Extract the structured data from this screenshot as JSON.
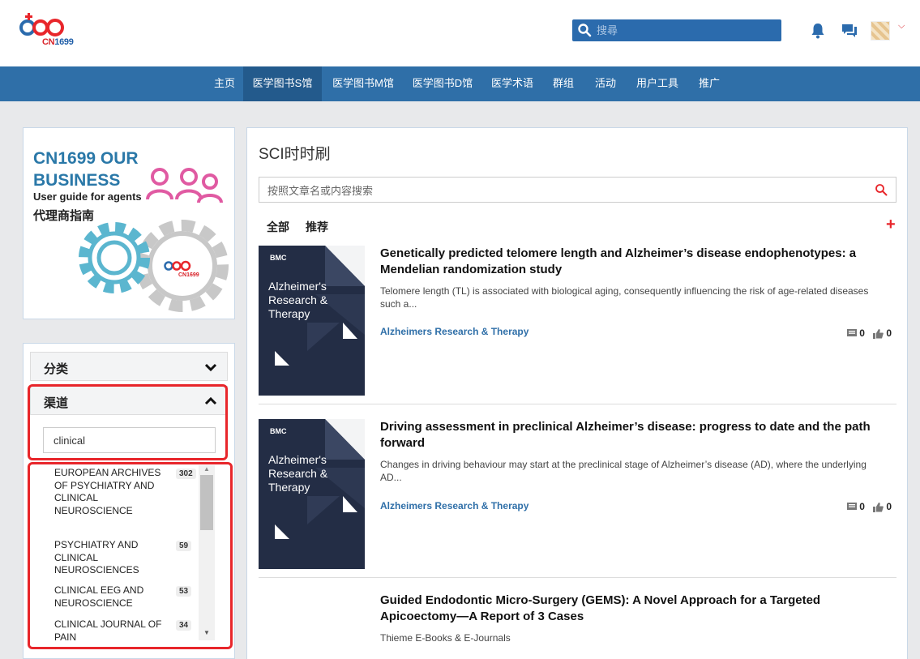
{
  "brand": {
    "logo_text_red": "CN",
    "logo_text_blue": "1699"
  },
  "header": {
    "search_placeholder": "搜尋"
  },
  "nav": {
    "items": [
      {
        "label": "主页"
      },
      {
        "label": "医学图书S馆"
      },
      {
        "label": "医学图书M馆"
      },
      {
        "label": "医学图书D馆"
      },
      {
        "label": "医学术语"
      },
      {
        "label": "群组"
      },
      {
        "label": "活动"
      },
      {
        "label": "用户工具"
      },
      {
        "label": "推广"
      }
    ],
    "active_index": 1
  },
  "ad": {
    "title_line1": "CN1699 OUR",
    "title_line2": "BUSINESS",
    "subtitle_en": "User guide for agents",
    "subtitle_cn": "代理商指南",
    "logo_text": "CN1699"
  },
  "filter": {
    "category_label": "分类",
    "channel_label": "渠道",
    "channel_query": "clinical",
    "channels": [
      {
        "name": "EUROPEAN ARCHIVES OF PSYCHIATRY AND CLINICAL NEUROSCIENCE",
        "count": "302"
      },
      {
        "name": "PSYCHIATRY AND CLINICAL NEUROSCIENCES",
        "count": "59"
      },
      {
        "name": "CLINICAL EEG AND NEUROSCIENCE",
        "count": "53"
      },
      {
        "name": "CLINICAL JOURNAL OF PAIN",
        "count": "34"
      }
    ]
  },
  "main": {
    "title": "SCI时时刷",
    "search_placeholder": "按照文章名或内容搜索",
    "tabs": [
      {
        "label": "全部"
      },
      {
        "label": "推荐"
      }
    ],
    "add_symbol": "+",
    "articles": [
      {
        "title": "Genetically predicted telomere length and Alzheimer’s disease endophenotypes: a Mendelian randomization study",
        "desc": "Telomere length (TL) is associated with biological aging, consequently influencing the risk of age-related diseases such a...",
        "journal": "Alzheimers Research & Therapy",
        "comments": "0",
        "likes": "0",
        "cover": {
          "publisher": "BMC",
          "line1": "Alzheimer's",
          "line2": "Research &",
          "line3": "Therapy"
        }
      },
      {
        "title": "Driving assessment in preclinical Alzheimer’s disease: progress to date and the path forward",
        "desc": "Changes in driving behaviour may start at the preclinical stage of Alzheimer’s disease (AD), where the underlying AD...",
        "journal": "Alzheimers Research & Therapy",
        "comments": "0",
        "likes": "0",
        "cover": {
          "publisher": "BMC",
          "line1": "Alzheimer's",
          "line2": "Research &",
          "line3": "Therapy"
        }
      },
      {
        "title": "Guided Endodontic Micro-Surgery (GEMS): A Novel Approach for a Targeted Apicoectomy—A Report of 3 Cases",
        "source": "Thieme E-Books & E-Journals"
      }
    ]
  },
  "colors": {
    "nav": "#2f6fa8",
    "accent_red": "#e8262b",
    "link": "#2f6fa8"
  }
}
